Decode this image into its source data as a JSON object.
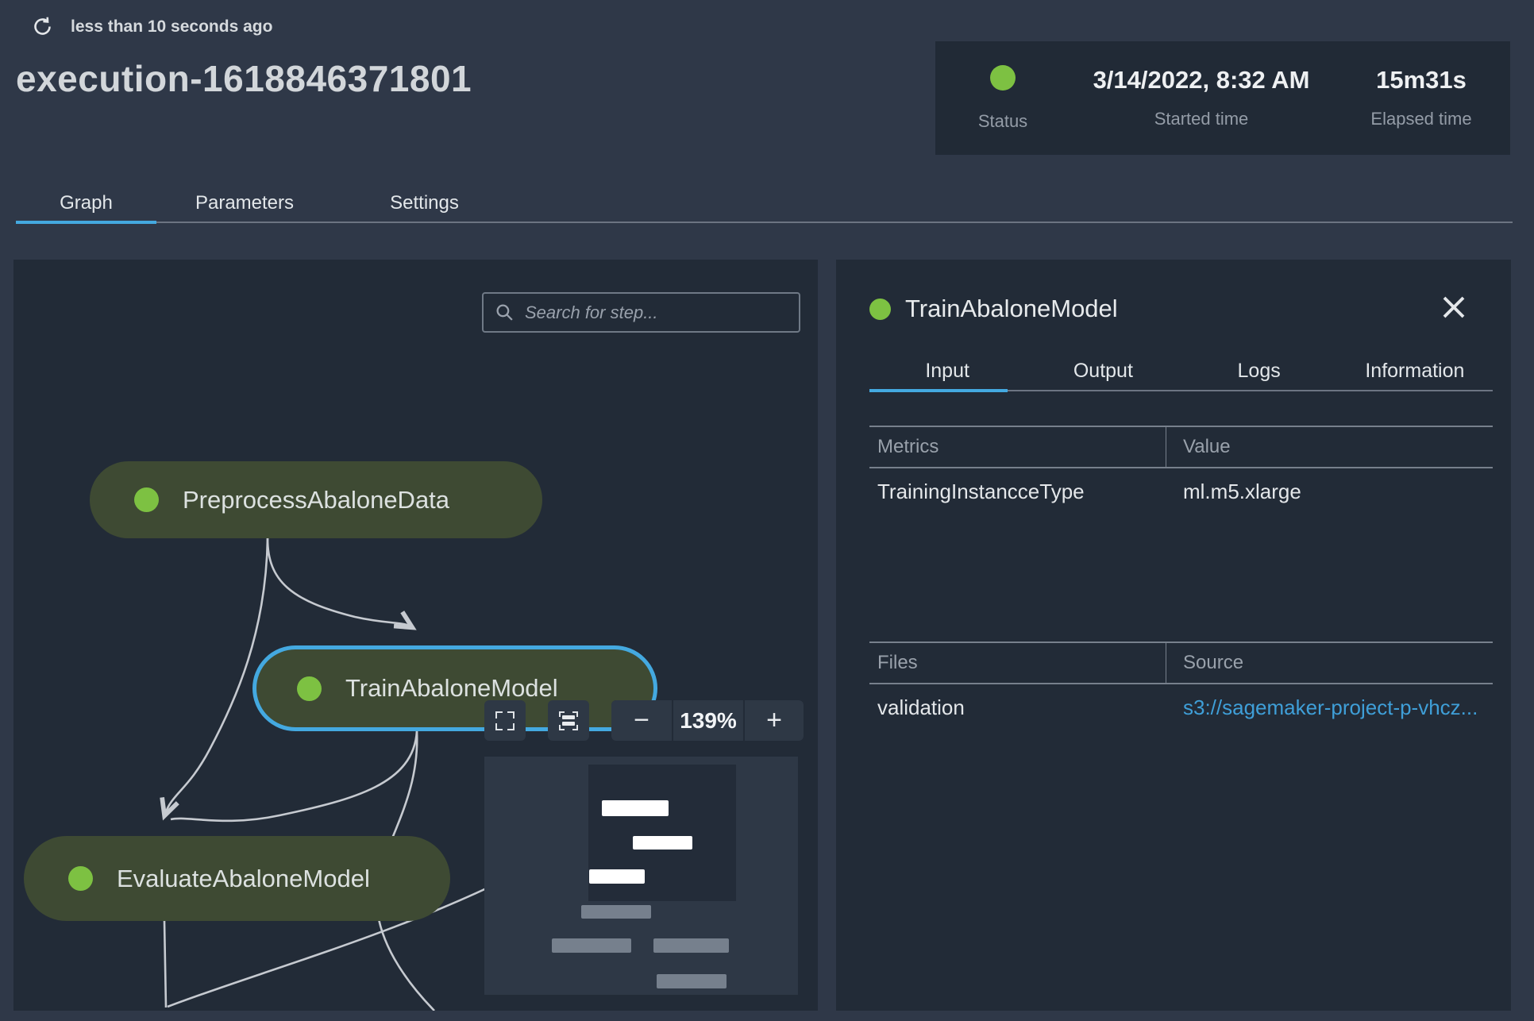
{
  "colors": {
    "accent_blue": "#44a9e0",
    "status_green": "#7dc142",
    "link_blue": "#3f9fd8",
    "panel_bg": "#222b37",
    "page_bg": "#2f3848",
    "node_green": "#3e4a33"
  },
  "header": {
    "refreshed_text": "less than 10 seconds ago",
    "title": "execution-1618846371801",
    "status_card": {
      "status_label": "Status",
      "started_label": "Started time",
      "started_value": "3/14/2022, 8:32 AM",
      "elapsed_label": "Elapsed time",
      "elapsed_value": "15m31s"
    }
  },
  "tabs": [
    {
      "label": "Graph",
      "active": true
    },
    {
      "label": "Parameters",
      "active": false
    },
    {
      "label": "Settings",
      "active": false
    }
  ],
  "graph": {
    "search_placeholder": "Search for step...",
    "zoom_controls": {
      "level": "139%",
      "minus": "−",
      "plus": "+"
    },
    "nodes": [
      {
        "label": "PreprocessAbaloneData",
        "status": "succeeded",
        "selected": false
      },
      {
        "label": "TrainAbaloneModel",
        "status": "succeeded",
        "selected": true
      },
      {
        "label": "EvaluateAbaloneModel",
        "status": "succeeded",
        "selected": false
      }
    ]
  },
  "detail": {
    "title": "TrainAbaloneModel",
    "status": "succeeded",
    "tabs": [
      {
        "label": "Input",
        "active": true
      },
      {
        "label": "Output",
        "active": false
      },
      {
        "label": "Logs",
        "active": false
      },
      {
        "label": "Information",
        "active": false
      }
    ],
    "metrics_table": {
      "col1": "Metrics",
      "col2": "Value",
      "rows": [
        {
          "c1": "TrainingInstancceType",
          "c2": "ml.m5.xlarge"
        }
      ]
    },
    "files_table": {
      "col1": "Files",
      "col2": "Source",
      "rows": [
        {
          "c1": "validation",
          "c2": "s3://sagemaker-project-p-vhcz..."
        }
      ]
    }
  }
}
